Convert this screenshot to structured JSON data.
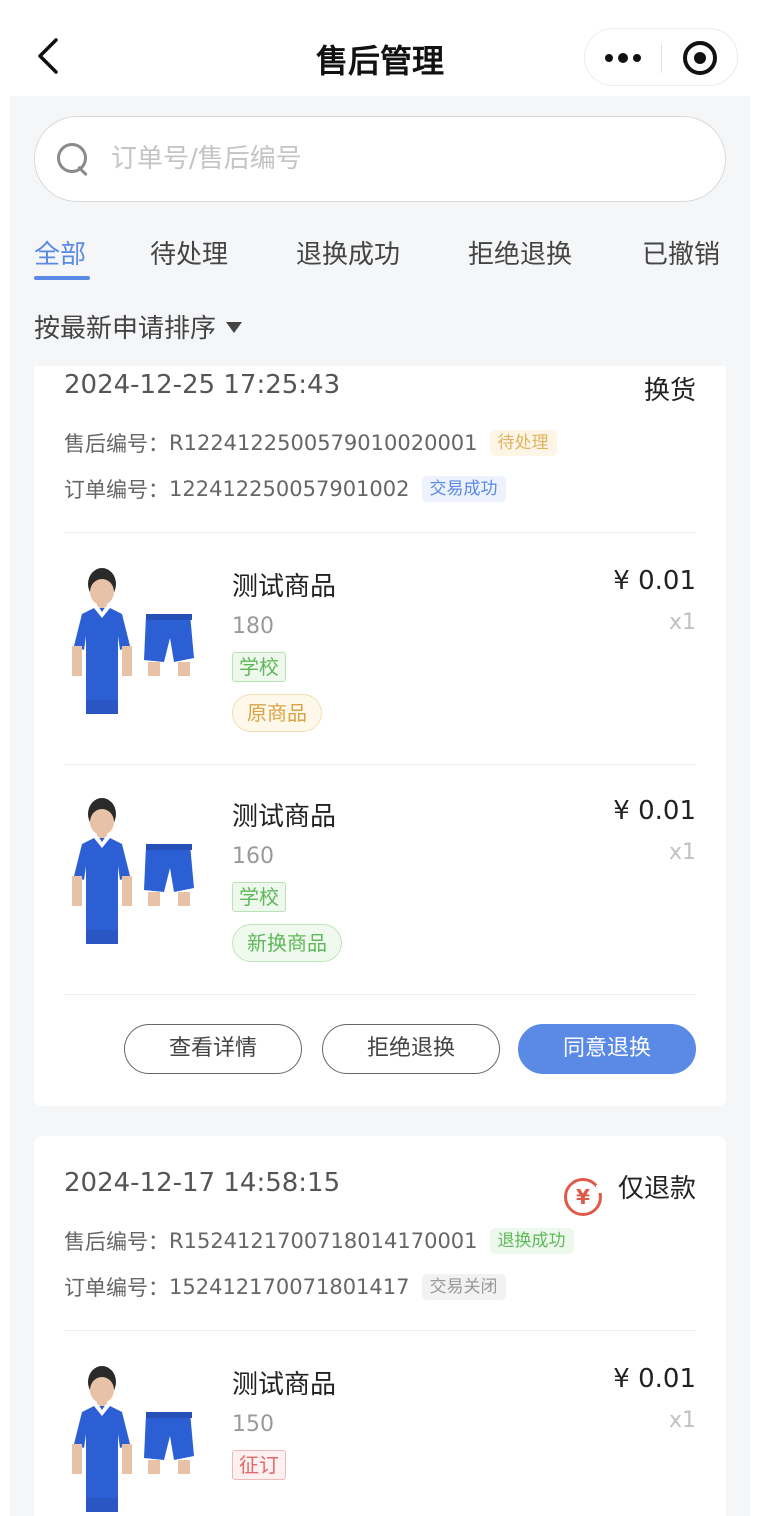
{
  "nav": {
    "title": "售后管理"
  },
  "search": {
    "placeholder": "订单号/售后编号"
  },
  "tabs": [
    {
      "label": "全部",
      "active": true
    },
    {
      "label": "待处理"
    },
    {
      "label": "退换成功"
    },
    {
      "label": "拒绝退换"
    },
    {
      "label": "已撤销"
    }
  ],
  "sort": {
    "label": "按最新申请排序"
  },
  "colors": {
    "accent": "#5a8ae6",
    "pending": "#e0b25e",
    "success": "#5fb85a",
    "refund_red": "#e05a4a"
  },
  "orders": [
    {
      "time": "2024-12-25 17:25:43",
      "type": "换货",
      "service_label": "售后编号：",
      "service_no": "R122412250057901002000​1",
      "service_status": "待处理",
      "order_label": "订单编号：",
      "order_no": "122412250057901002",
      "order_status": "交易成功",
      "products": [
        {
          "name": "测试商品",
          "spec": "180",
          "price": "¥ 0.01",
          "qty": "x1",
          "tag": "学校",
          "role": "原商品",
          "image": "school-uniform-blue"
        },
        {
          "name": "测试商品",
          "spec": "160",
          "price": "¥ 0.01",
          "qty": "x1",
          "tag": "学校",
          "role": "新换商品",
          "image": "school-uniform-blue"
        }
      ],
      "actions": {
        "detail": "查看详情",
        "reject": "拒绝退换",
        "agree": "同意退换"
      }
    },
    {
      "time": "2024-12-17 14:58:15",
      "type": "仅退款",
      "type_icon": "yen-refund-icon",
      "type_icon_glyph": "¥",
      "service_label": "售后编号：",
      "service_no": "R152412170071801417000​1",
      "service_status": "退换成功",
      "order_label": "订单编号：",
      "order_no": "152412170071801417",
      "order_status": "交易关闭",
      "products": [
        {
          "name": "测试商品",
          "spec": "150",
          "price": "¥ 0.01",
          "qty": "x1",
          "tag": "征订",
          "image": "school-uniform-blue"
        }
      ]
    }
  ]
}
